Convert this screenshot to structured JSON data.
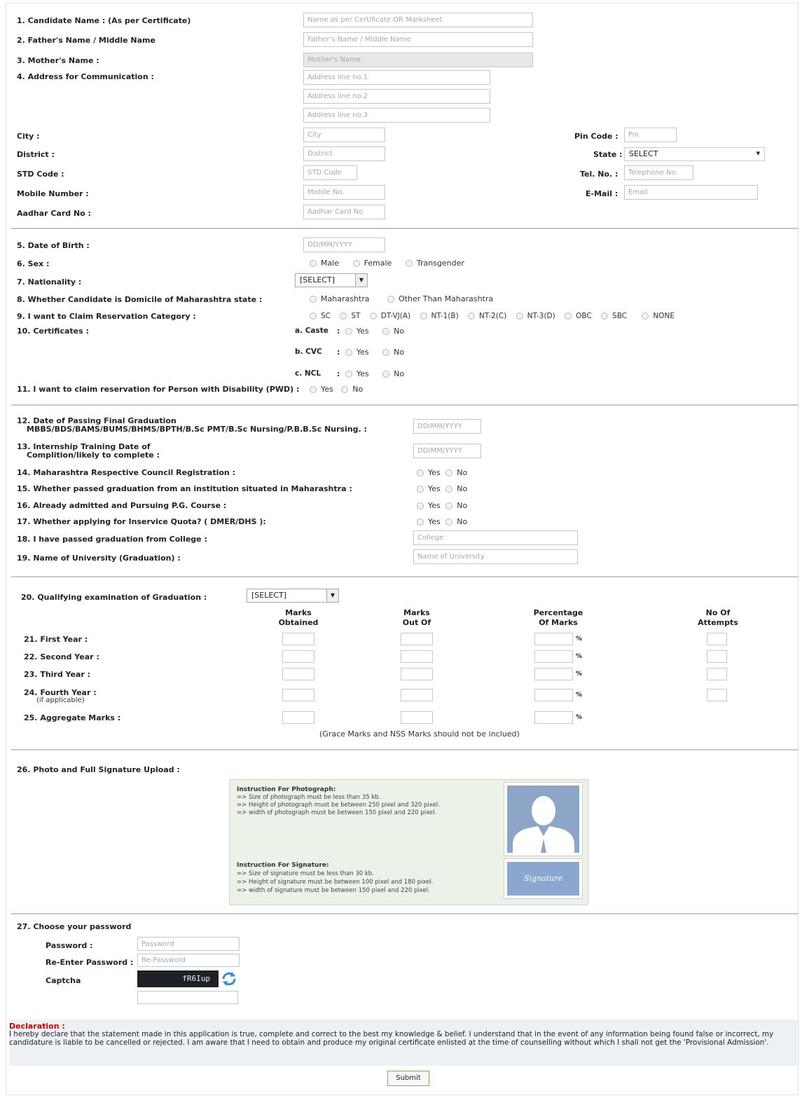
{
  "personal": {
    "candidate_name": {
      "label": "1. Candidate Name : (As per Certificate)",
      "placeholder": "Name as per Certificate OR Marksheet"
    },
    "father_name": {
      "label": "2. Father's Name / Middle Name",
      "placeholder": "Father's Name / Middle Name"
    },
    "mother_name": {
      "label": "3. Mother's Name :",
      "placeholder": "Mother's Name"
    },
    "address": {
      "label": "4. Address for Communication :",
      "line1": "Address line no.1",
      "line2": "Address line no.2",
      "line3": "Address line no.3"
    },
    "city": {
      "label": "City :",
      "placeholder": "City"
    },
    "pin": {
      "label": "Pin Code :",
      "placeholder": "Pin"
    },
    "district": {
      "label": "District :",
      "placeholder": "District"
    },
    "state": {
      "label": "State :",
      "value": "SELECT"
    },
    "std": {
      "label": "STD Code :",
      "placeholder": "STD Code"
    },
    "tel": {
      "label": "Tel. No. :",
      "placeholder": "Telephone No."
    },
    "mobile": {
      "label": "Mobile Number :",
      "placeholder": "Mobile No."
    },
    "email": {
      "label": "E-Mail :",
      "placeholder": "Email"
    },
    "aadhar": {
      "label": "Aadhar Card No :",
      "placeholder": "Aadhar Card No"
    }
  },
  "details": {
    "dob": {
      "label": "5. Date of Birth :",
      "placeholder": "DD/MM/YYYY"
    },
    "sex": {
      "label": "6. Sex :",
      "options": [
        "Male",
        "Female",
        "Transgender"
      ]
    },
    "nationality": {
      "label": "7. Nationality :",
      "value": "[SELECT]"
    },
    "domicile": {
      "label": "8. Whether Candidate is Domicile of Maharashtra state :",
      "options": [
        "Maharashtra",
        "Other Than Maharashtra"
      ]
    },
    "category": {
      "label": "9. I want to Claim Reservation Category :",
      "options": [
        "SC",
        "ST",
        "DT-VJ(A)",
        "NT-1(B)",
        "NT-2(C)",
        "NT-3(D)",
        "OBC",
        "SBC",
        "NONE"
      ]
    },
    "certificates": {
      "label": "10. Certificates :",
      "caste": "a. Caste",
      "cvc": "b. CVC",
      "ncl": "c. NCL",
      "colon": ":",
      "yes": "Yes",
      "no": "No"
    },
    "pwd": {
      "label": "11. I want to claim reservation for Person with Disability (PWD) :",
      "yes": "Yes",
      "no": "No"
    }
  },
  "graduation": {
    "passing_date": {
      "label1": "12. Date of Passing Final Graduation",
      "label2": "MBBS/BDS/BAMS/BUMS/BHMS/BPTH/B.Sc PMT/B.Sc Nursing/P.B.B.Sc Nursing. :",
      "placeholder": "DD/MM/YYYY"
    },
    "internship": {
      "label1": "13. Internship Training Date of",
      "label2": "Complition/likely to complete :",
      "placeholder": "DD/MM/YYYY"
    },
    "q14": "14. Maharashtra Respective Council Registration :",
    "q15": "15. Whether passed graduation from an institution situated in Maharashtra :",
    "q16": "16. Already admitted and Pursuing P.G. Course :",
    "q17": "17. Whether applying for Inservice Quota? ( DMER/DHS ):",
    "yes": "Yes",
    "no": "No",
    "college": {
      "label": "18. I have passed graduation from College :",
      "placeholder": "College"
    },
    "university": {
      "label": "19. Name of University (Graduation) :",
      "placeholder": "Name of University"
    }
  },
  "marks": {
    "qualifying": {
      "label": "20. Qualifying examination of Graduation :",
      "value": "[SELECT]"
    },
    "headers": {
      "obtained1": "Marks",
      "obtained2": "Obtained",
      "outof1": "Marks",
      "outof2": "Out Of",
      "pct1": "Percentage",
      "pct2": "Of Marks",
      "att1": "No Of",
      "att2": "Attempts"
    },
    "rows": [
      "21. First Year :",
      "22. Second Year :",
      "23. Third Year :",
      "24. Fourth Year :",
      "25. Aggregate Marks :"
    ],
    "if_applicable": "(if applicable)",
    "pct_sign": "%",
    "note": "(Grace Marks and NSS Marks should not be inclued)"
  },
  "upload": {
    "label": "26. Photo and Full Signature Upload :",
    "photo_title": "Instruction For Photograph:",
    "photo_lines": [
      "=> Size of photograph must be less than 35 kb.",
      "=> Height of photograph must be between 250 pixel and 320 pixel.",
      "=> width of photograph must be between 150 pixel and 220 pixel."
    ],
    "sig_title": "Instruction For Signature:",
    "sig_lines": [
      "=> Size of signature must be less than 30 kb.",
      "=> Height of signature must be between 100 pixel and 180 pixel.",
      "=> width of signature must be between 150 pixel and 220 pixel."
    ],
    "signature_preview_text": "Signature"
  },
  "password": {
    "section": "27. Choose your password",
    "pwd_label": "Password :",
    "pwd_placeholder": "Password",
    "repwd_label": "Re-Enter Password :",
    "repwd_placeholder": "Re-Password",
    "captcha_label": "Captcha",
    "captcha_text": "fR6Iup"
  },
  "declaration": {
    "title": "Declaration :",
    "text": "I hereby declare that the statement made in this application is true, complete and correct to the best my knowledge & belief. I understand that in the event of any information being found false or incorrect, my candidature is liable to be cancelled or rejected. I am aware that I need to obtain and produce my original certificate enlisted at the time of counselling without which I shall not get the 'Provisional Admission'."
  },
  "submit_label": "Submit",
  "colors": {
    "declaration_title": "#cc0000",
    "upload_bg": "#edf2e8",
    "captcha_bg": "#1e2126",
    "refresh_icon": "#2b8fd6",
    "photo_bg": "#8da6c8"
  }
}
